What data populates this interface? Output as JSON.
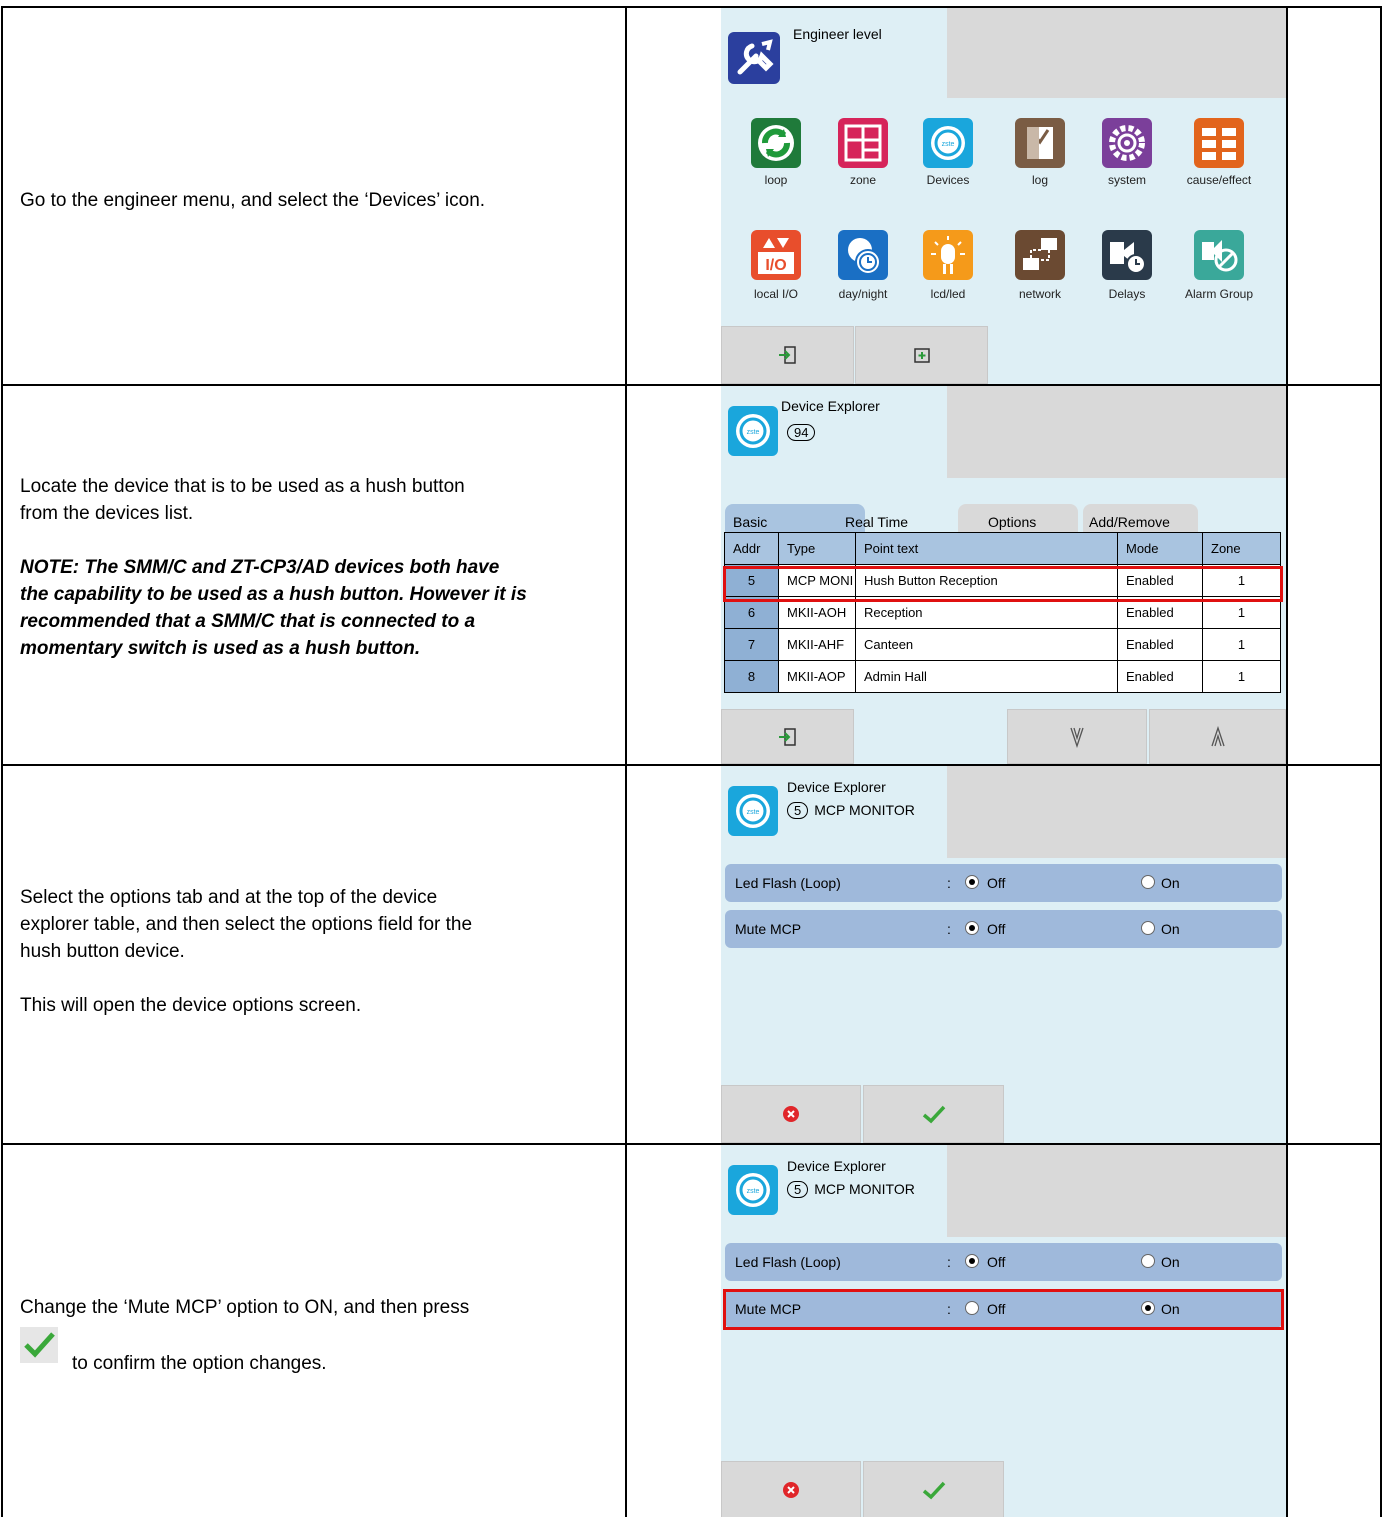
{
  "rows": [
    {
      "instruction": "Go to the engineer menu, and select the ‘Devices’ icon.",
      "screen": {
        "title": "Engineer level",
        "icons": [
          "loop",
          "zone",
          "Devices",
          "log",
          "system",
          "cause/effect",
          "local I/O",
          "day/night",
          "lcd/led",
          "network",
          "Delays",
          "Alarm Group"
        ]
      }
    },
    {
      "instruction_1": "Locate the device that is to be used as a hush button",
      "instruction_2": "from the devices list.",
      "note_1": "NOTE: The SMM/C and ZT-CP3/AD devices both have",
      "note_2": "the capability to be used as a hush button. However it is",
      "note_3": "recommended that a SMM/C that is connected to a",
      "note_4": "momentary switch is used as a hush button.",
      "screen": {
        "title": "Device Explorer",
        "count": "94",
        "tabs": [
          "Basic",
          "Real Time",
          "Options",
          "Add/Remove"
        ],
        "columns": [
          "Addr",
          "Type",
          "Point text",
          "Mode",
          "Zone"
        ],
        "devices": [
          {
            "addr": "5",
            "type": "MCP MONI",
            "text": "Hush Button Reception",
            "mode": "Enabled",
            "zone": "1"
          },
          {
            "addr": "6",
            "type": "MKII-AOH",
            "text": "Reception",
            "mode": "Enabled",
            "zone": "1"
          },
          {
            "addr": "7",
            "type": "MKII-AHF",
            "text": "Canteen",
            "mode": "Enabled",
            "zone": "1"
          },
          {
            "addr": "8",
            "type": "MKII-AOP",
            "text": "Admin Hall",
            "mode": "Enabled",
            "zone": "1"
          }
        ]
      }
    },
    {
      "instruction_1": "Select the options tab and at the top of the device",
      "instruction_2": "explorer table, and then select the options field for the",
      "instruction_3": "hush button device.",
      "instruction_4": "This will open the device options screen.",
      "screen": {
        "title": "Device Explorer",
        "addr": "5",
        "device": "MCP MONITOR",
        "options": [
          {
            "label": "Led Flash (Loop)",
            "colon": ":",
            "off": "Off",
            "on": "On",
            "value": "Off"
          },
          {
            "label": "Mute MCP",
            "colon": ":",
            "off": "Off",
            "on": "On",
            "value": "Off"
          }
        ]
      }
    },
    {
      "instruction_1": "Change the ‘Mute MCP’ option to ON, and then press",
      "instruction_2": "to confirm the option changes.",
      "screen": {
        "title": "Device Explorer",
        "addr": "5",
        "device": "MCP MONITOR",
        "options": [
          {
            "label": "Led Flash (Loop)",
            "colon": ":",
            "off": "Off",
            "on": "On",
            "value": "Off"
          },
          {
            "label": "Mute MCP",
            "colon": ":",
            "off": "Off",
            "on": "On",
            "value": "On"
          }
        ]
      }
    }
  ],
  "colors": {
    "panel_bg": "#deeff5",
    "row_blue": "#9fb9db",
    "highlight": "#e01010",
    "header_blue": "#a9c4e0"
  }
}
